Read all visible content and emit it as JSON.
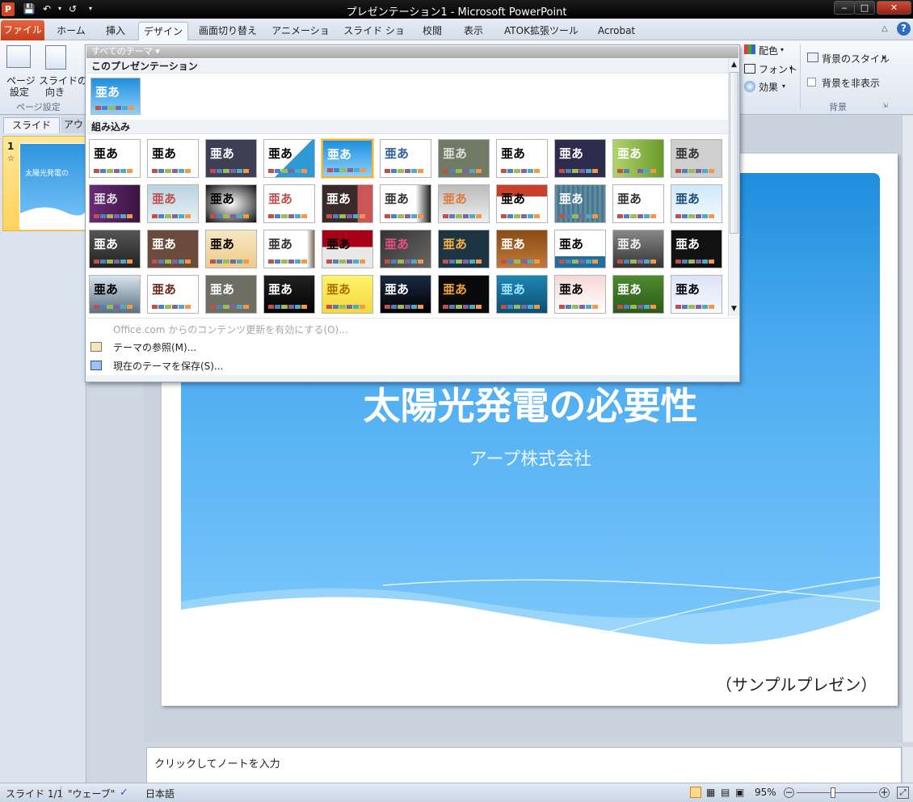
{
  "window": {
    "title": "プレゼンテーション1 - Microsoft PowerPoint",
    "app_badge": "P"
  },
  "tabs": {
    "file": "ファイル",
    "items": [
      "ホーム",
      "挿入",
      "デザイン",
      "画面切り替え",
      "アニメーション",
      "スライド ショー",
      "校閲",
      "表示",
      "ATOK拡張ツール",
      "Acrobat"
    ],
    "active": "デザイン"
  },
  "ribbon": {
    "page_setup_label": "ページ設定",
    "page_setup_l1": "ページ",
    "page_setup_l2": "設定",
    "orientation_l1": "スライドの",
    "orientation_l2": "向き",
    "group_page": "ページ設定",
    "colors": "配色",
    "fonts": "フォント",
    "effects": "効果",
    "bg_styles": "背景のスタイル",
    "hide_bg": "背景を非表示",
    "group_bg": "背景"
  },
  "gallery": {
    "header": "すべてのテーマ",
    "this_presentation": "このプレゼンテーション",
    "builtin": "組み込み",
    "sample_text": "亜あ",
    "menu": {
      "office_update": "Office.com からのコンテンツ更新を有効にする(O)...",
      "browse": "テーマの参照(M)...",
      "save": "現在のテーマを保存(S)..."
    }
  },
  "left_pane": {
    "tab_slides": "スライド",
    "tab_outline": "アウ",
    "slide_number": "1",
    "thumb_title": "太陽光発電の"
  },
  "slide": {
    "title": "太陽光発電の必要性",
    "subtitle": "アープ株式会社",
    "footer_text": "（サンプルプレゼン）"
  },
  "notes": {
    "placeholder": "クリックしてノートを入力"
  },
  "status": {
    "slide_pos": "スライド 1/1",
    "theme": "\"ウェーブ\"",
    "language": "日本語",
    "zoom": "95%"
  },
  "colors": {
    "accent_orange": "#f0b33a",
    "file_tab": "#d24726",
    "slide_blue": "#4aaaf0"
  }
}
